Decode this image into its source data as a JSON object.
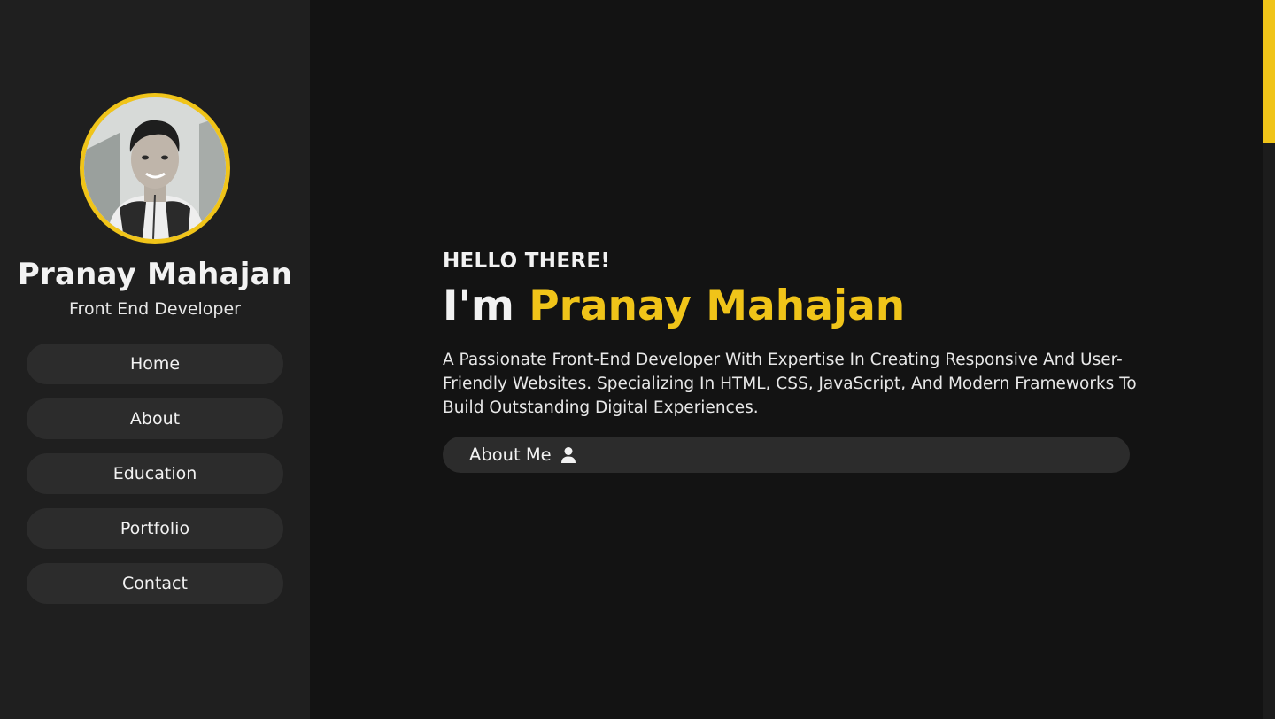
{
  "sidebar": {
    "name": "Pranay Mahajan",
    "role": "Front End Developer",
    "nav": [
      {
        "label": "Home"
      },
      {
        "label": "About"
      },
      {
        "label": "Education"
      },
      {
        "label": "Portfolio"
      },
      {
        "label": "Contact"
      }
    ]
  },
  "hero": {
    "greeting": "HELLO THERE!",
    "headline_prefix": "I'm ",
    "headline_name": "Pranay Mahajan",
    "intro": "A Passionate Front-End Developer With Expertise In Creating Responsive And User-Friendly Websites. Specializing In HTML, CSS, JavaScript, And Modern Frameworks To Build Outstanding Digital Experiences.",
    "about_button": "About Me",
    "about_icon": "user-icon"
  },
  "colors": {
    "accent": "#f0c419",
    "background": "#131313",
    "sidebar": "#1f1f1f",
    "pill": "#2c2c2c"
  }
}
